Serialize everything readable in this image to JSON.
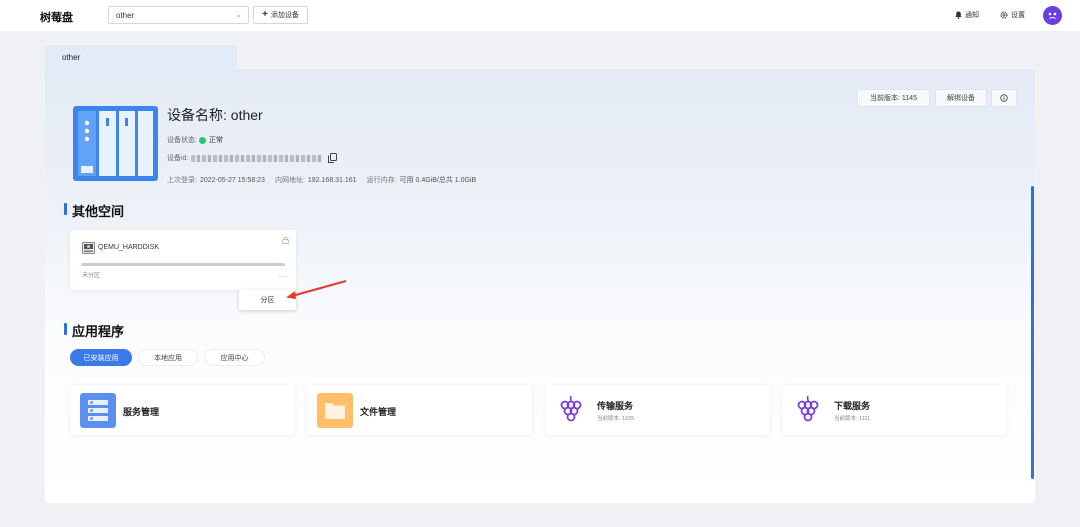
{
  "topbar": {
    "brand": "树莓盘",
    "device_select": "other",
    "add_device_label": "添加设备",
    "notify_label": "通知",
    "settings_label": "设置"
  },
  "device": {
    "tab_label": "other",
    "title": "设备名称: other",
    "status_label": "设备状态:",
    "status_value": "正常",
    "id_label": "设备id:",
    "last_login_label": "上次登录:",
    "last_login_value": "2022-05-27 15:58:23",
    "ip_label": "内网地址:",
    "ip_value": "192.168.31.161",
    "memory_label": "运行内存:",
    "memory_value": "可用 0.4GiB/总共 1.0GiB",
    "version_button": "当前版本: 1145",
    "unbind_button": "解绑设备"
  },
  "other_space": {
    "title": "其他空间",
    "disk_name": "QEMU_HARDDISK",
    "disk_state": "未分区",
    "more": "...",
    "menu_item": "分区"
  },
  "apps": {
    "title": "应用程序",
    "tabs": [
      "已安装应用",
      "本地应用",
      "应用中心"
    ],
    "cards": [
      {
        "name": "服务管理",
        "sub": ""
      },
      {
        "name": "文件管理",
        "sub": ""
      },
      {
        "name": "传输服务",
        "sub": "当前版本: 1035"
      },
      {
        "name": "下载服务",
        "sub": "当前版本: 1111"
      }
    ]
  },
  "colors": {
    "accent": "#2f6fe0",
    "status_ok": "#25c76a",
    "avatar": "#6a3fe0",
    "grape": "#7c3fd6"
  }
}
